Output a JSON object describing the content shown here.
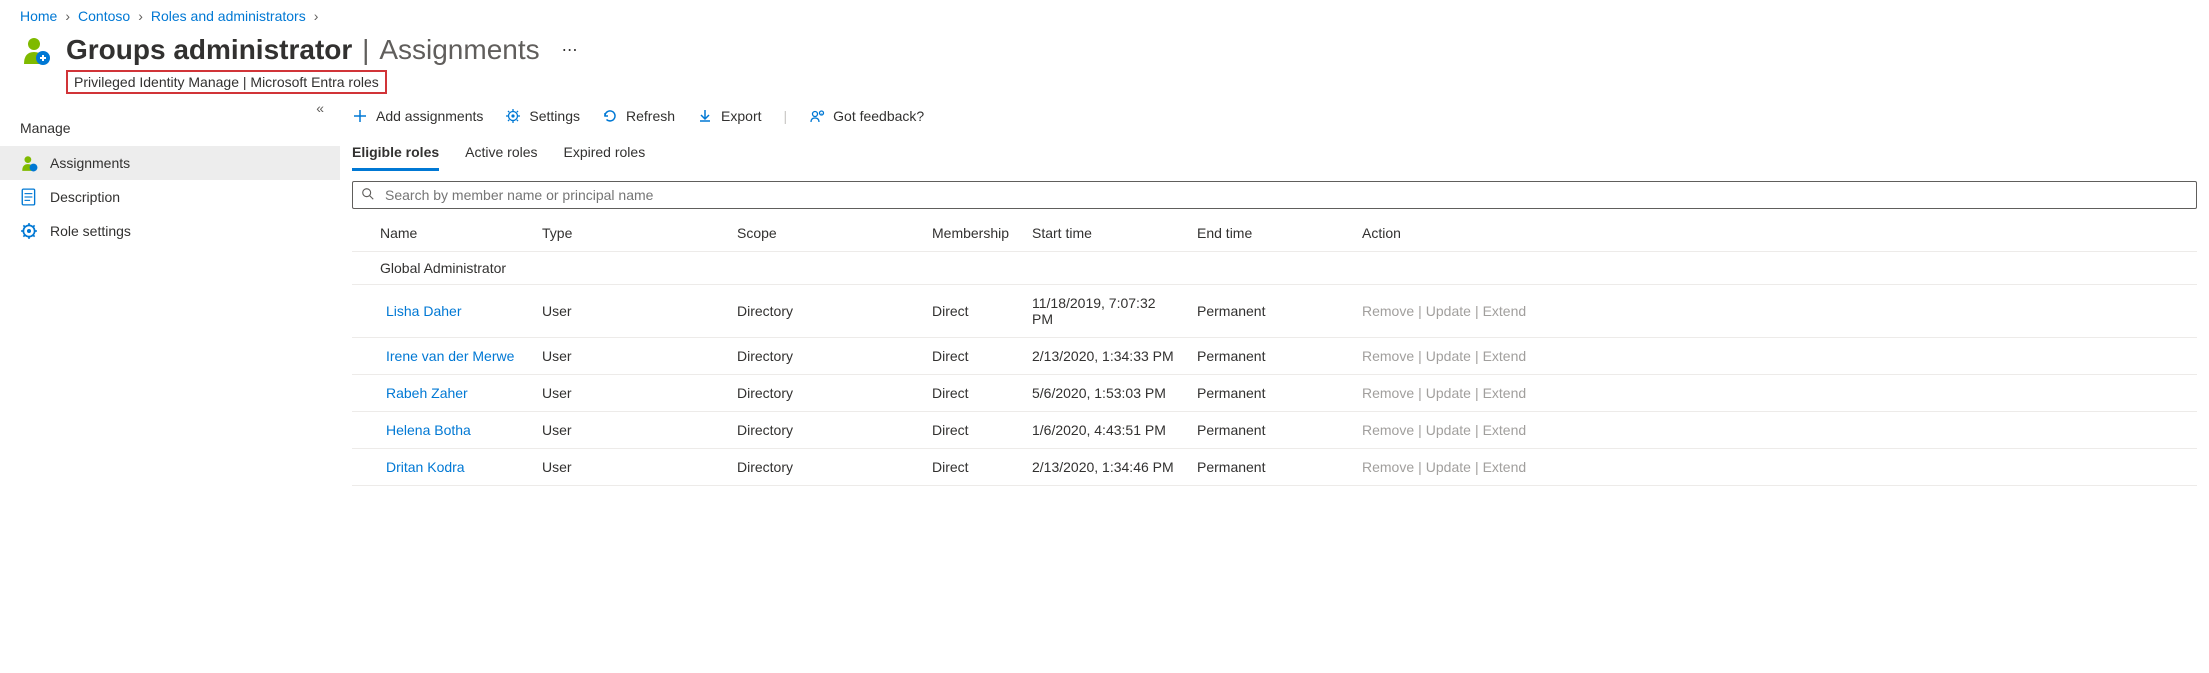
{
  "breadcrumb": [
    {
      "label": "Home"
    },
    {
      "label": "Contoso"
    },
    {
      "label": "Roles and administrators"
    }
  ],
  "header": {
    "title": "Groups administrator",
    "subtitle": "Assignments",
    "sub_line": "Privileged Identity Manage | Microsoft Entra roles"
  },
  "sidebar": {
    "section": "Manage",
    "items": [
      {
        "label": "Assignments",
        "icon": "person-icon",
        "active": true
      },
      {
        "label": "Description",
        "icon": "document-icon",
        "active": false
      },
      {
        "label": "Role settings",
        "icon": "gear-icon",
        "active": false
      }
    ]
  },
  "toolbar": {
    "add": "Add assignments",
    "settings": "Settings",
    "refresh": "Refresh",
    "export": "Export",
    "feedback": "Got feedback?"
  },
  "tabs": [
    {
      "label": "Eligible roles",
      "active": true
    },
    {
      "label": "Active roles",
      "active": false
    },
    {
      "label": "Expired roles",
      "active": false
    }
  ],
  "search": {
    "placeholder": "Search by member name or principal name"
  },
  "columns": {
    "name": "Name",
    "type": "Type",
    "scope": "Scope",
    "membership": "Membership",
    "start": "Start time",
    "end": "End time",
    "action": "Action"
  },
  "group_label": "Global Administrator",
  "actions": {
    "remove": "Remove",
    "update": "Update",
    "extend": "Extend"
  },
  "rows": [
    {
      "name": "Lisha Daher",
      "type": "User",
      "scope": "Directory",
      "membership": "Direct",
      "start": "11/18/2019, 7:07:32 PM",
      "end": "Permanent"
    },
    {
      "name": "Irene van der Merwe",
      "type": "User",
      "scope": "Directory",
      "membership": "Direct",
      "start": "2/13/2020, 1:34:33 PM",
      "end": "Permanent"
    },
    {
      "name": "Rabeh Zaher",
      "type": "User",
      "scope": "Directory",
      "membership": "Direct",
      "start": "5/6/2020, 1:53:03 PM",
      "end": "Permanent"
    },
    {
      "name": "Helena Botha",
      "type": "User",
      "scope": "Directory",
      "membership": "Direct",
      "start": "1/6/2020, 4:43:51 PM",
      "end": "Permanent"
    },
    {
      "name": "Dritan Kodra",
      "type": "User",
      "scope": "Directory",
      "membership": "Direct",
      "start": "2/13/2020, 1:34:46 PM",
      "end": "Permanent"
    }
  ]
}
